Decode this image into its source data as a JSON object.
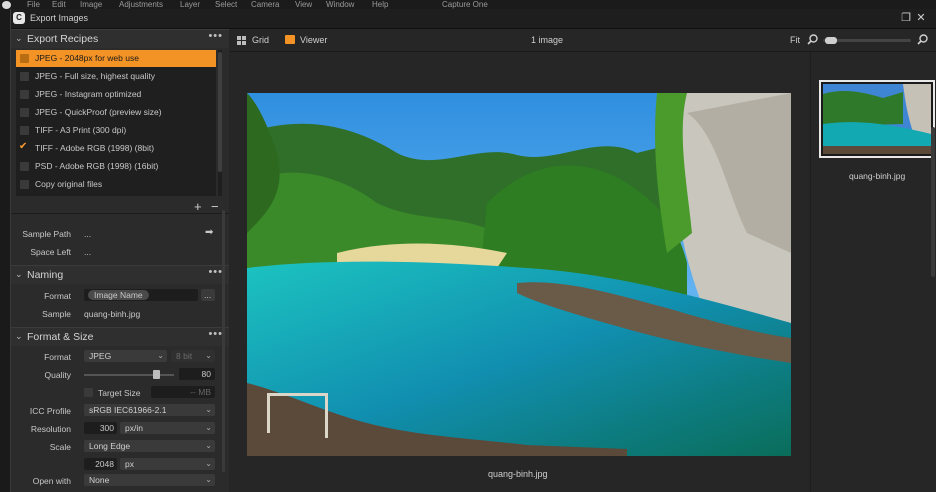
{
  "menubar": {
    "items": [
      "File",
      "Edit",
      "Image",
      "Adjustments",
      "Layer",
      "Select",
      "Camera",
      "View",
      "Window",
      "Help"
    ],
    "app_title": "Capture One"
  },
  "window": {
    "title": "Export Images",
    "restore_glyph": "❐",
    "close_glyph": "✕"
  },
  "recipes": {
    "heading": "Export Recipes",
    "items": [
      {
        "label": "JPEG - 2048px for web use",
        "selected": true,
        "checked": false
      },
      {
        "label": "JPEG - Full size, highest quality",
        "selected": false,
        "checked": false
      },
      {
        "label": "JPEG - Instagram optimized",
        "selected": false,
        "checked": false
      },
      {
        "label": "JPEG - QuickProof (preview size)",
        "selected": false,
        "checked": false
      },
      {
        "label": "TIFF - A3 Print (300 dpi)",
        "selected": false,
        "checked": false
      },
      {
        "label": "TIFF - Adobe RGB (1998) (8bit)",
        "selected": false,
        "checked": true
      },
      {
        "label": "PSD - Adobe RGB (1998) (16bit)",
        "selected": false,
        "checked": false
      },
      {
        "label": "Copy original files",
        "selected": false,
        "checked": false
      }
    ],
    "add_glyph": "+",
    "remove_glyph": "−"
  },
  "location": {
    "sample_path_label": "Sample Path",
    "sample_path_value": "...",
    "space_left_label": "Space Left",
    "space_left_value": "..."
  },
  "naming": {
    "heading": "Naming",
    "format_label": "Format",
    "format_token": "Image Name",
    "format_more": "...",
    "sample_label": "Sample",
    "sample_value": "quang-binh.jpg"
  },
  "format_size": {
    "heading": "Format & Size",
    "format_label": "Format",
    "format_value": "JPEG",
    "bit_value": "8 bit",
    "quality_label": "Quality",
    "quality_value": "80",
    "quality_fraction": 0.8,
    "target_size_label": "Target Size",
    "target_size_unit": "MB",
    "target_size_value": "--",
    "icc_label": "ICC Profile",
    "icc_value": "sRGB IEC61966-2.1",
    "resolution_label": "Resolution",
    "resolution_value": "300",
    "resolution_unit": "px/in",
    "scale_label": "Scale",
    "scale_value": "Long Edge",
    "scale_amount": "2048",
    "scale_unit": "px",
    "open_with_label": "Open with",
    "open_with_value": "None"
  },
  "toolbar": {
    "grid_label": "Grid",
    "viewer_label": "Viewer",
    "count": "1 image",
    "fit_label": "Fit"
  },
  "viewer": {
    "caption": "quang-binh.jpg"
  },
  "browser": {
    "thumb_caption": "quang-binh.jpg"
  }
}
